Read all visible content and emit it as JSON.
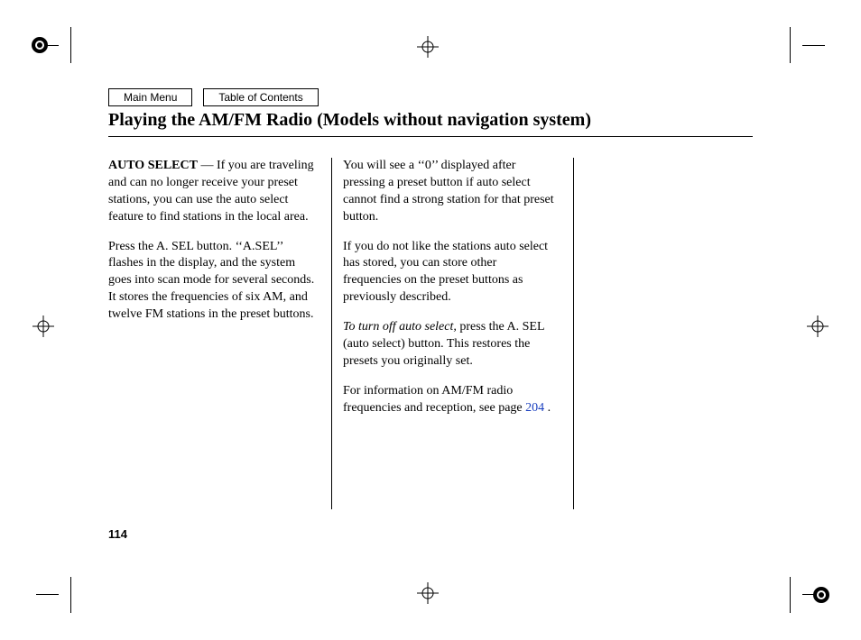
{
  "nav": {
    "main_menu": "Main Menu",
    "toc": "Table of Contents"
  },
  "heading": "Playing the AM/FM Radio (Models without navigation system)",
  "col1": {
    "auto_select_label": "AUTO SELECT",
    "p1_rest": " — If you are traveling and can no longer receive your preset stations, you can use the auto select feature to find stations in the local area.",
    "p2": "Press the A. SEL button. ‘‘A.SEL’’ flashes in the display, and the system goes into scan mode for several seconds. It stores the frequencies of six AM, and twelve FM stations in the preset buttons."
  },
  "col2": {
    "p1": "You will see a ‘‘0’’ displayed after pressing a preset button if auto select cannot find a strong station for that preset button.",
    "p2": "If you do not like the stations auto select has stored, you can store other frequencies on the preset buttons as previously described.",
    "p3_italic": "To turn off auto select,",
    "p3_rest": " press the A. SEL (auto select) button. This restores the presets you originally set.",
    "p4a": "For information on AM/FM radio frequencies and reception, see page ",
    "p4_link": "204",
    "p4b": " ."
  },
  "page_number": "114"
}
